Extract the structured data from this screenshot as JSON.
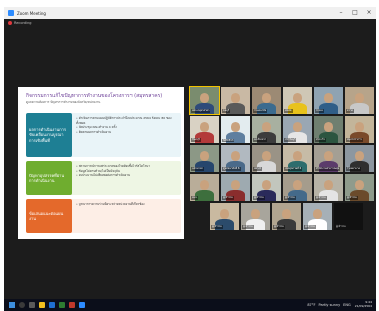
{
  "window": {
    "title": "Zoom Meeting",
    "controls": [
      "–",
      "□",
      "×"
    ]
  },
  "recording": {
    "label": "Recording"
  },
  "slide": {
    "title": "กิจกรรมการแก้ไขปัญหาการทำงานของโครงการฯ (สมุทรสาคร)",
    "subtitle": "ดูแลความต้องการ ปัญหาการทำงานของจังหวัด/หน่วยงาน",
    "rows": [
      {
        "label": "ผลการดำเนินงานการขับเคลื่อนงานบูรณาการเชิงพื้นที่",
        "lines": [
          "• ดำเนินการตามแผนปฏิบัติการประจำปีงบประมาณ 2564 ร้อยละ 80 ของทั้งหมด",
          "• จัดประชุม คณะทำงาน 4 ครั้ง",
          "• ติดตามผลการดำเนินงาน"
        ]
      },
      {
        "label": "ปัญหาอุปสรรคที่ผ่านการดำเนินงาน",
        "lines": [
          "• สถานการณ์การแพร่ระบาดของโรคติดเชื้อไวรัสโคโรนา",
          "• ข้อมูลไม่ครบถ้วน/ไม่เป็นปัจจุบัน",
          "• งบประมาณไม่เพียงพอต่อการดำเนินงาน"
        ]
      },
      {
        "label": "ข้อเสนอแนะต่อแผนงาน",
        "lines": [
          "• บูรณาการความร่วมมือระหว่างหน่วยงานที่เกี่ยวข้อง"
        ]
      }
    ]
  },
  "gallery": {
    "tiles": [
      {
        "name": "สสจ.สมุทรสาคร",
        "bg": "#7a8c6e",
        "shirt": "#2e4b7a"
      },
      {
        "name": "ชลบุรี",
        "bg": "#c9b9a4",
        "shirt": "#5a5a5a"
      },
      {
        "name": "กรมอนามัย",
        "bg": "#9c8a74",
        "shirt": "#3b6b8f"
      },
      {
        "name": "สปสช.",
        "bg": "#cfc7b5",
        "shirt": "#e8c21c"
      },
      {
        "name": "ระยอง",
        "bg": "#8fa3b2",
        "shirt": "#2f5e88"
      },
      {
        "name": "ตราด",
        "bg": "#b7a48a",
        "shirt": "#c8c8c8"
      },
      {
        "name": "จันทบุรี",
        "bg": "#d9d2c4",
        "shirt": "#b33a3a"
      },
      {
        "name": "SMOE13",
        "bg": "#e3ecef",
        "shirt": "#5f7f9f"
      },
      {
        "name": "ฉะเชิงเทรา",
        "bg": "#a8b0a0",
        "shirt": "#3c3c3c"
      },
      {
        "name": "ปราจีนบุรี",
        "bg": "#9aa7b3",
        "shirt": "#e6e6e6"
      },
      {
        "name": "สระแก้ว",
        "bg": "#6f7f70",
        "shirt": "#2c5540"
      },
      {
        "name": "สมุทรปราการ",
        "bg": "#c3b59a",
        "shirt": "#7a4a2a"
      },
      {
        "name": "นครนายก",
        "bg": "#8c9886",
        "shirt": "#26466d"
      },
      {
        "name": "ศูนย์อนามัยที่ 6",
        "bg": "#b1b9c0",
        "shirt": "#4a6a8a"
      },
      {
        "name": "สคร.6",
        "bg": "#9a9386",
        "shirt": "#d8d8d8"
      },
      {
        "name": "เขตสุขภาพที่ 6",
        "bg": "#c6bba6",
        "shirt": "#2d6d6d"
      },
      {
        "name": "สำนักงานสาธารณสุข",
        "bg": "#a49f94",
        "shirt": "#5b3b6b"
      },
      {
        "name": "โรงพยาบาล",
        "bg": "#8d97a0",
        "shirt": "#2f2f2f"
      },
      {
        "name": "อบจ.",
        "bg": "#b9ad99",
        "shirt": "#3d6f3d"
      },
      {
        "name": "ผู้เข้าร่วม",
        "bg": "#9eaab0",
        "shirt": "#8a2d2d"
      },
      {
        "name": "ผู้เข้าร่วม",
        "bg": "#c2c6bd",
        "shirt": "#2a2a5a"
      },
      {
        "name": "ผู้เข้าร่วม",
        "bg": "#a59c8c",
        "shirt": "#446a8a"
      },
      {
        "name": "ผู้เข้าร่วม",
        "bg": "#b7b3a6",
        "shirt": "#e4e4e4"
      },
      {
        "name": "ผู้เข้าร่วม",
        "bg": "#8f9b8c",
        "shirt": "#6b4b2b"
      },
      {
        "name": "ผู้เข้าร่วม",
        "bg": "#c9b9a0",
        "shirt": "#2b4b6b"
      },
      {
        "name": "ผู้เข้าร่วม",
        "bg": "#a8a59c",
        "shirt": "#f0f0f0"
      },
      {
        "name": "ผู้เข้าร่วม",
        "bg": "#b1a590",
        "shirt": "#3a3a3a"
      },
      {
        "name": "ผู้เข้าร่วม",
        "bg": "#a6b0b7",
        "shirt": "#ffffff"
      },
      {
        "name": "ผู้เข้าร่วม",
        "bg": "#222222",
        "shirt": "#222222",
        "dark": true
      }
    ]
  },
  "taskbar": {
    "tray": [
      "87°F",
      "Partly sunny",
      "ENG"
    ],
    "time": "9:44",
    "date": "21/09/2564"
  }
}
